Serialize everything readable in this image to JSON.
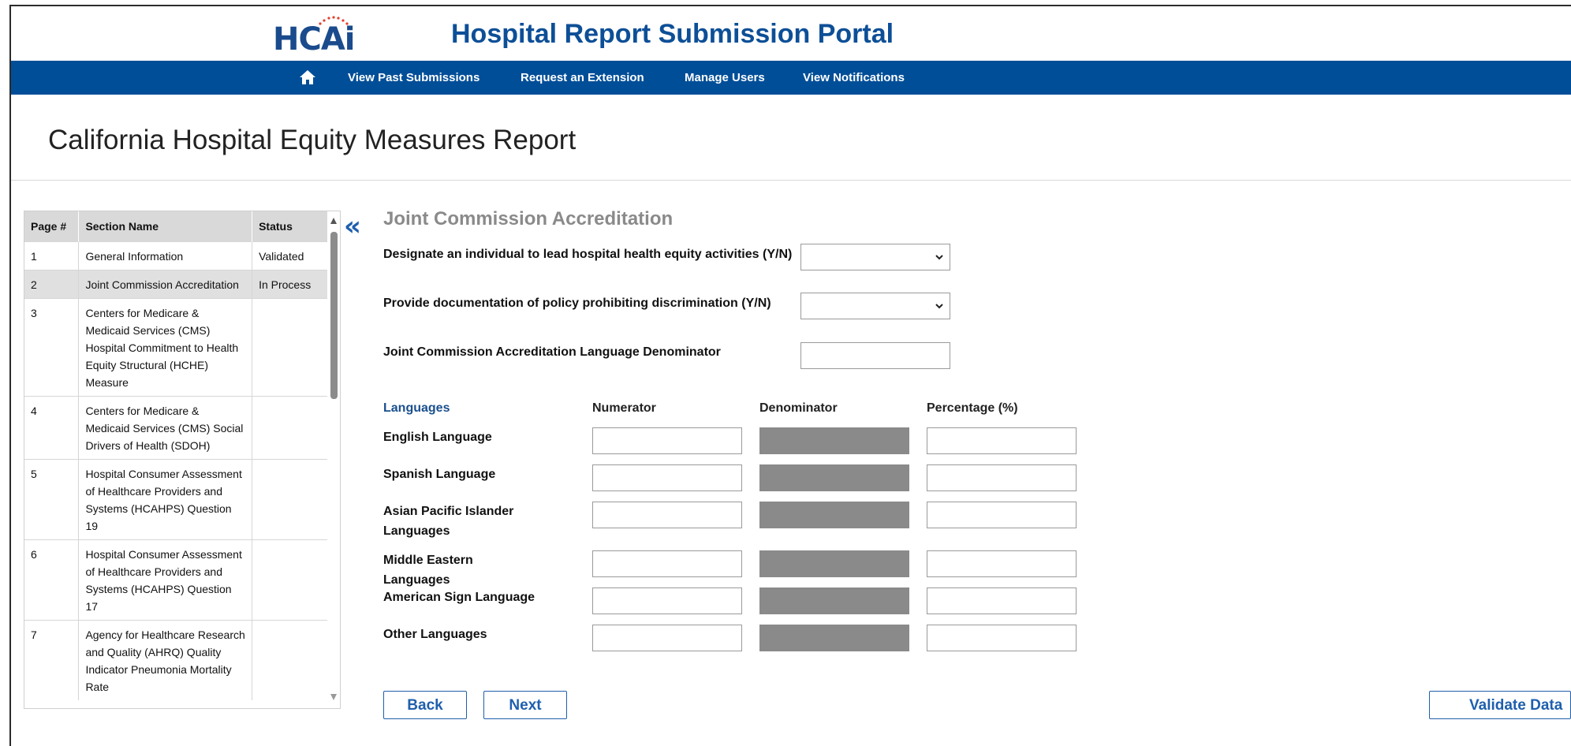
{
  "header": {
    "logo_text": "HCAi",
    "portal_title": "Hospital Report Submission Portal"
  },
  "nav": {
    "home_icon": "home-icon",
    "items": [
      "View Past Submissions",
      "Request an Extension",
      "Manage Users",
      "View Notifications"
    ]
  },
  "page": {
    "title": "California Hospital Equity Measures Report"
  },
  "sidebar": {
    "columns": [
      "Page #",
      "Section Name",
      "Status"
    ],
    "rows": [
      {
        "page": "1",
        "section": "General Information",
        "status": "Validated"
      },
      {
        "page": "2",
        "section": "Joint Commission Accreditation",
        "status": "In Process"
      },
      {
        "page": "3",
        "section": "Centers for Medicare & Medicaid Services (CMS) Hospital Commitment to Health Equity Structural (HCHE) Measure",
        "status": ""
      },
      {
        "page": "4",
        "section": "Centers for Medicare & Medicaid Services (CMS) Social Drivers of Health (SDOH)",
        "status": ""
      },
      {
        "page": "5",
        "section": "Hospital Consumer Assessment of Healthcare Providers and Systems (HCAHPS) Question 19",
        "status": ""
      },
      {
        "page": "6",
        "section": "Hospital Consumer Assessment of Healthcare Providers and Systems (HCAHPS) Question 17",
        "status": ""
      },
      {
        "page": "7",
        "section": "Agency for Healthcare Research and Quality (AHRQ) Quality Indicator Pneumonia Mortality Rate",
        "status": ""
      }
    ],
    "collapse_icon": "double-chevron-left-icon"
  },
  "form": {
    "section_title": "Joint Commission Accreditation",
    "q1_label": "Designate an individual to lead hospital health equity activities (Y/N)",
    "q1_value": "",
    "q2_label": "Provide documentation of policy prohibiting discrimination  (Y/N)",
    "q2_value": "",
    "q3_label": "Joint Commission Accreditation Language Denominator",
    "q3_value": "",
    "table_headers": [
      "Languages",
      "Numerator",
      "Denominator",
      "Percentage (%)"
    ],
    "languages": [
      {
        "label": "English Language",
        "numerator": "",
        "percentage": ""
      },
      {
        "label": "Spanish Language",
        "numerator": "",
        "percentage": ""
      },
      {
        "label": "Asian Pacific Islander Languages",
        "numerator": "",
        "percentage": ""
      },
      {
        "label": "Middle Eastern Languages",
        "numerator": "",
        "percentage": ""
      },
      {
        "label": "American Sign Language",
        "numerator": "",
        "percentage": ""
      },
      {
        "label": "Other Languages",
        "numerator": "",
        "percentage": ""
      }
    ]
  },
  "buttons": {
    "back": "Back",
    "next": "Next",
    "validate": "Validate Data"
  },
  "colors": {
    "nav_bg": "#014e98",
    "title_blue": "#0d4f97",
    "accent_blue": "#1f5fad",
    "disabled_gray": "#8a8a8a"
  }
}
